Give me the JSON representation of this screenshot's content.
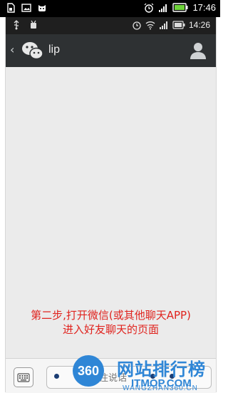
{
  "outer_status": {
    "time": "17:46"
  },
  "inner_status": {
    "time": "14:26"
  },
  "header": {
    "title": "lip"
  },
  "annotation": {
    "line1": "第二步,打开微信(或其他聊天APP)",
    "line2": "进入好友聊天的页面"
  },
  "input_bar": {
    "hold_to_talk": "按住说话"
  },
  "watermark": {
    "badge": "360",
    "title": "网站排行榜",
    "subtitle": "ITMOP.COM",
    "url": "WANGZHAN360.CN"
  },
  "colors": {
    "annotation": "#e0231e",
    "titlebar": "#2e3133",
    "chat_bg": "#ebebeb",
    "watermark": "#2f86d6"
  }
}
